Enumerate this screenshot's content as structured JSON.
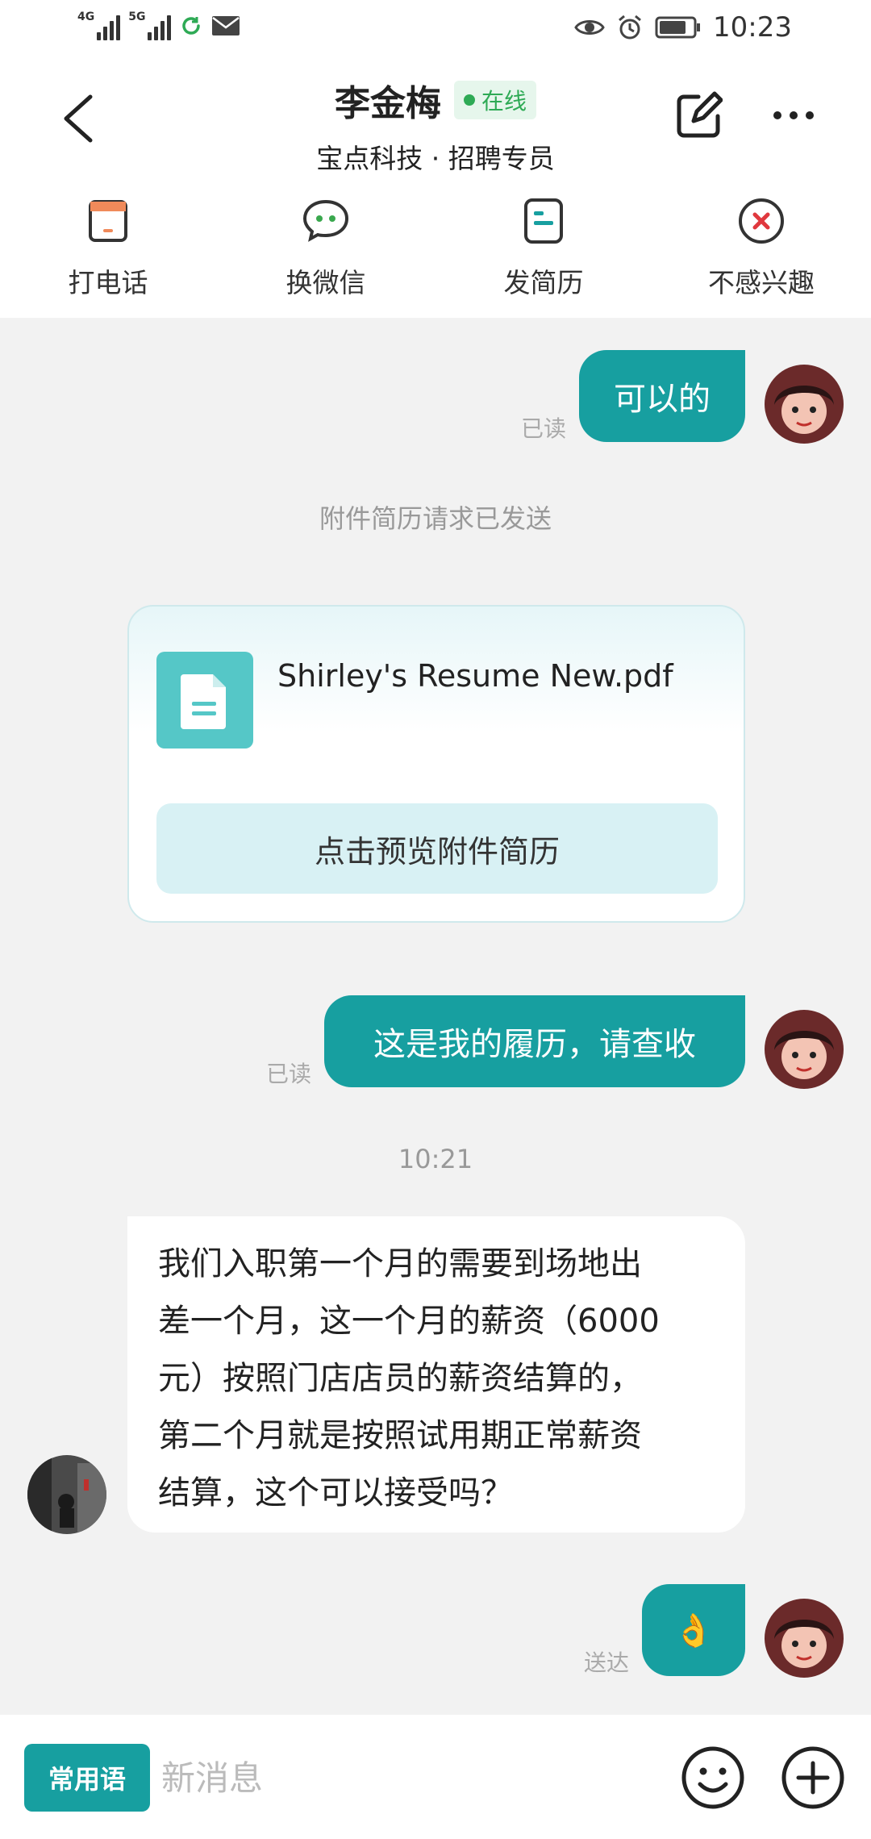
{
  "status_bar": {
    "net1": "4G",
    "net2": "5G",
    "time": "10:23"
  },
  "header": {
    "contact_name": "李金梅",
    "online_label": "在线",
    "subtitle": "宝点科技 · 招聘专员"
  },
  "actions": [
    {
      "label": "打电话",
      "icon": "phone-icon"
    },
    {
      "label": "换微信",
      "icon": "wechat-icon"
    },
    {
      "label": "发简历",
      "icon": "resume-icon"
    },
    {
      "label": "不感兴趣",
      "icon": "not-interested-icon"
    }
  ],
  "messages": {
    "m1_text": "可以的",
    "m1_status": "已读",
    "sys1": "附件简历请求已发送",
    "file_name": "Shirley's Resume New.pdf",
    "preview_label": "点击预览附件简历",
    "m2_text": "这是我的履历，请查收",
    "m2_status": "已读",
    "time_divider": "10:21",
    "m3_lines": [
      "我们入职第一个月的需要到场地出",
      "差一个月，这一个月的薪资（6000",
      "元）按照门店店员的薪资结算的，",
      "第二个月就是按照试用期正常薪资",
      "结算，这个可以接受吗？"
    ],
    "m4_text": "👌",
    "m4_status": "送达"
  },
  "input_bar": {
    "phrase_label": "常用语",
    "placeholder": "新消息"
  },
  "colors": {
    "teal": "#179fa0",
    "online_green": "#2eaa55"
  }
}
